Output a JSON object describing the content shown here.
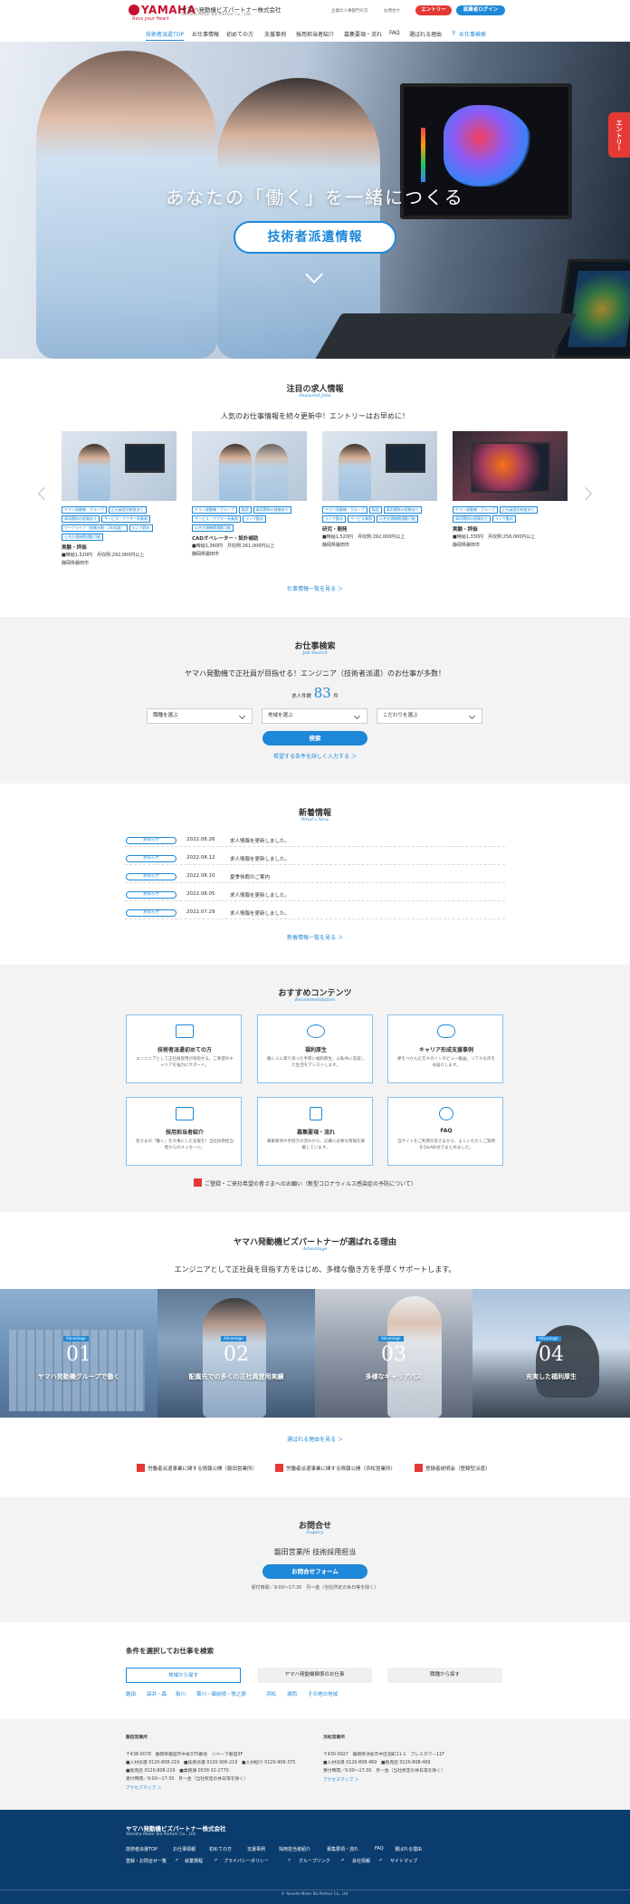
{
  "header": {
    "logo_text": "YAMAHA",
    "logo_tagline": "Revs your Heart",
    "company_name": "ヤマハ発動機ビズパートナー株式会社",
    "company_name_en": "Yamaha Motor Biz Partner Co., Ltd.",
    "util_links": [
      "企業の人事部門の方",
      "お問合せ"
    ],
    "entry_label": "エントリー",
    "login_label": "就業者ログイン",
    "nav": [
      "技術者派遣TOP",
      "お仕事情報",
      "初めての方",
      "支援事例",
      "採用担当者紹介",
      "募集要項・流れ",
      "FAQ",
      "選ばれる理由"
    ],
    "search_label": "お仕事検索"
  },
  "hero": {
    "copy": "あなたの「働く」を一緒につくる",
    "button_label": "技術者派遣情報",
    "side_entry": "エントリー"
  },
  "featured": {
    "title": "注目の求人情報",
    "subtitle": "Featured Jobs",
    "lead": "人気のお仕事情報を続々更新中！エントリーはお早めに！",
    "jobs": [
      {
        "tags": [
          "ヤマハ発動機・グループ",
          "正社員登用制度あり",
          "車両関係の経験あり",
          "サービス・アフター系業務",
          "ワークライフ（経験年数・2年程度）",
          "ランク勤め",
          "公共交通機関通勤可能"
        ],
        "title": "実験・評価",
        "lines": [
          "■時給1,520円　月収例:292,000円以上",
          "静岡県磐田市"
        ]
      },
      {
        "tags": [
          "ヤマハ発動機・グループ",
          "製造",
          "車両関係の経験あり",
          "サービス・アフター系業務",
          "ランク勤め",
          "公共交通機関通勤可能"
        ],
        "title": "CADオペレーター・設計補助",
        "lines": [
          "■時給1,360円　月収例:261,000円以上",
          "静岡県磐田市"
        ]
      },
      {
        "tags": [
          "ヤマハ発動機・グループ",
          "製造",
          "車両関係の経験あり",
          "ランク勤め",
          "サービス業務",
          "公共交通機関通勤可能"
        ],
        "title": "研究・開発",
        "lines": [
          "■時給1,520円　月収例:292,000円以上",
          "静岡県磐田市"
        ]
      },
      {
        "tags": [
          "ヤマハ発動機・グループ",
          "正社員登用制度あり",
          "車両関係の経験あり",
          "ランク勤め"
        ],
        "title": "実験・評価",
        "lines": [
          "■時給1,330円　月収例:256,000円以上",
          "静岡県磐田市"
        ]
      }
    ],
    "more": "仕事情報一覧を見る ＞"
  },
  "search": {
    "title": "お仕事検索",
    "subtitle": "Job Search",
    "lead": "ヤマハ発動機で正社員が目指せる！エンジニア（技術者派遣）のお仕事が多数！",
    "count_label": "求人件数",
    "count": "83",
    "count_unit": "件",
    "selects": [
      "職種を選ぶ",
      "地域を選ぶ",
      "こだわりを選ぶ"
    ],
    "button": "検索",
    "detail_link": "希望する条件を詳しく入力する ＞"
  },
  "news": {
    "title": "新着情報",
    "subtitle": "What's New",
    "items": [
      {
        "badge": "お知らせ",
        "date": "2022.08.26",
        "text": "求人情報を更新しました。"
      },
      {
        "badge": "お知らせ",
        "date": "2022.08.12",
        "text": "求人情報を更新しました。"
      },
      {
        "badge": "お知らせ",
        "date": "2022.08.10",
        "text": "夏季休暇のご案内"
      },
      {
        "badge": "お知らせ",
        "date": "2022.08.05",
        "text": "求人情報を更新しました。"
      },
      {
        "badge": "お知らせ",
        "date": "2022.07.29",
        "text": "求人情報を更新しました。"
      }
    ],
    "more": "新着情報一覧を見る ＞"
  },
  "recommend": {
    "title": "おすすめコンテンツ",
    "subtitle": "Recommendation",
    "cards": [
      {
        "icon": "book-icon",
        "title": "技術者派遣初めての方",
        "desc": "エンジニアとして正社員登用が目指せる。ご希望のキャリアを強力にサポート。"
      },
      {
        "icon": "heart-hand-icon",
        "title": "福利厚生",
        "desc": "働く人に寄り添った手厚い福利厚生。公私共に充実した生活をアシストします。"
      },
      {
        "icon": "chat-people-icon",
        "title": "キャリア形成支援事例",
        "desc": "夢をつかんだ方々のインタビュー動画。リアルな声をお届けします。"
      },
      {
        "icon": "profile-card-icon",
        "title": "採用担当者紹介",
        "desc": "皆さまの「働く」を大事にした支援を！当社採用担当者からのメッセージ。"
      },
      {
        "icon": "document-icon",
        "title": "募集要項・流れ",
        "desc": "募集要項や手続きの流れから、応募に必要な情報を掲載しています。"
      },
      {
        "icon": "faq-icon",
        "title": "FAQ",
        "desc": "当サイトをご利用の皆さまから、よくいただくご質問をQ&A形式でまとめました。"
      }
    ],
    "notice": "ご登録・ご来社希望の皆さまへのお願い（新型コロナウィルス感染症の予防について）"
  },
  "reasons": {
    "title": "ヤマハ発動機ビズパートナーが選ばれる理由",
    "subtitle": "Advantage",
    "lead": "エンジニアとして正社員を目指す方をはじめ、多様な働き方を手厚くサポートします。",
    "items": [
      {
        "badge": "Advantage",
        "num": "01",
        "label": "ヤマハ発動機グループで働く"
      },
      {
        "badge": "Advantage",
        "num": "02",
        "label": "配属先での多くの正社員登用実績"
      },
      {
        "badge": "Advantage",
        "num": "03",
        "label": "多様なキャリアパス"
      },
      {
        "badge": "Advantage",
        "num": "04",
        "label": "充実した福利厚生"
      }
    ],
    "more": "選ばれる理由を見る ＞",
    "docs": [
      "労働者派遣事業に関する情報公開（磐田営業所）",
      "労働者派遣事業に関する情報公開（浜松営業所）",
      "登録者説明会（登録型派遣）"
    ]
  },
  "contact": {
    "title": "お問合せ",
    "subtitle": "Inquiry",
    "office": "磐田営業所 技術採用担当",
    "button": "お問合せフォーム",
    "hours": "受付時間／9:00〜17:30　月〜金（当社所定の休日等を除く）"
  },
  "condition": {
    "title": "条件を選択してお仕事を検索",
    "tabs": [
      "地域から探す",
      "ヤマハ発動機関係のお仕事",
      "職種から探す"
    ],
    "links": [
      "磐田",
      "袋井・森",
      "掛川",
      "菊川・御前崎・牧之原",
      "浜松",
      "湖西",
      "その他の地域"
    ]
  },
  "offices": [
    {
      "name": "磐田営業所",
      "lines": [
        "〒438-0078　静岡県磐田市中泉375番地　リベーラ磐田3F",
        "■人材派遣 0120-808-219　■技術派遣 0120-906-219　■人材紹介 0120-906-375",
        "■販売店 0120-808-219　■業務課 0538-32-2770",
        "受付時間／9:00〜17:30　月〜金（当社所定の休日等を除く）"
      ],
      "map": "アクセスマップ ＞"
    },
    {
      "name": "浜松営業所",
      "lines": [
        "〒430-0927　静岡県浜松市中区旭町11-1　プレスタワー11F",
        "■人材派遣 0120-808-469　■販売店 0120-808-469",
        "受付時間／9:00〜17:30　月〜金（当社所定の休日等を除く）"
      ],
      "map": "アクセスマップ ＞"
    }
  ],
  "footer": {
    "company": "ヤマハ発動機ビズパートナー株式会社",
    "company_en": "Yamaha Motor Biz Partner Co., Ltd.",
    "row1": [
      "技術者派遣TOP",
      "お仕事情報",
      "初めての方",
      "支援事例",
      "採用担当者紹介",
      "募集要項・流れ",
      "FAQ",
      "選ばれる理由"
    ],
    "row2": [
      "登録・お問合せ一覧",
      "就業規程",
      "プライバシーポリシー",
      "グループリンク",
      "会社情報",
      "サイトマップ"
    ],
    "copyright": "© Yamaha Motor Biz Partner Co., Ltd."
  },
  "colors": {
    "accent": "#1e88d8",
    "entry": "#e53935",
    "footer": "#0b3c6e",
    "section_bg": "#f3f3f3"
  }
}
